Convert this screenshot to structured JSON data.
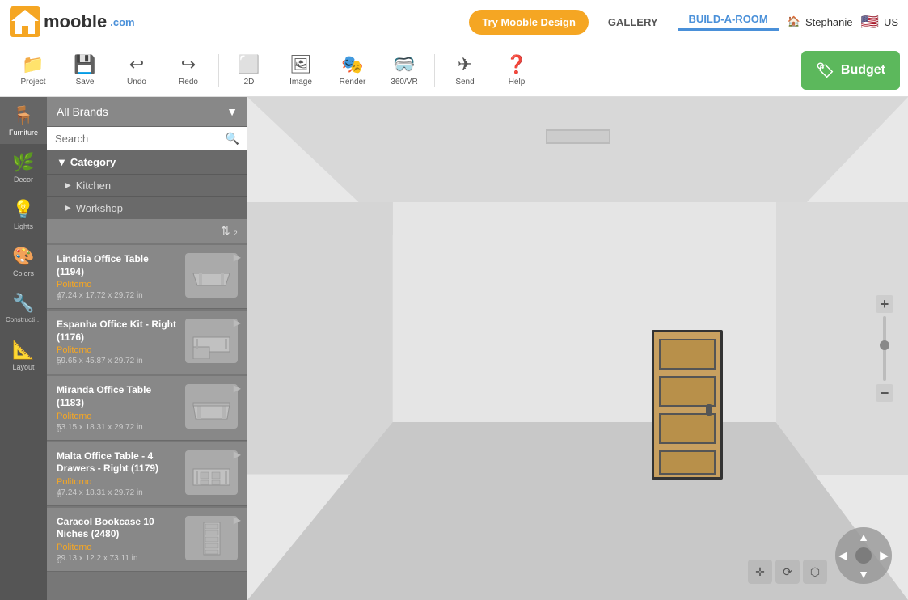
{
  "app": {
    "name": "mooble",
    "domain": ".com"
  },
  "topnav": {
    "try_btn": "Try Mooble Design",
    "gallery": "GALLERY",
    "build_a_room": "BUILD-A-ROOM",
    "user": "Stephanie",
    "region": "US"
  },
  "toolbar": {
    "project": "Project",
    "save": "Save",
    "undo": "Undo",
    "redo": "Redo",
    "twod": "2D",
    "image": "Image",
    "render": "Render",
    "vr": "360/VR",
    "send": "Send",
    "help": "Help",
    "budget": "Budget"
  },
  "sidebar": {
    "items": [
      {
        "label": "Furniture",
        "icon": "🪑"
      },
      {
        "label": "Decor",
        "icon": "🌿"
      },
      {
        "label": "Lights",
        "icon": "💡"
      },
      {
        "label": "Colors",
        "icon": "🎨"
      },
      {
        "label": "Construction",
        "icon": "🔧"
      },
      {
        "label": "Layout",
        "icon": "📐"
      }
    ]
  },
  "panel": {
    "brand_label": "All Brands",
    "search_placeholder": "Search",
    "category_header": "Category",
    "categories": [
      {
        "label": "Kitchen"
      },
      {
        "label": "Workshop"
      }
    ],
    "products": [
      {
        "name": "Lindóia Office Table (1194)",
        "brand": "Politorno",
        "dims": "47.24 x 17.72 x 29.72 in"
      },
      {
        "name": "Espanha Office Kit - Right (1176)",
        "brand": "Politorno",
        "dims": "59.65 x 45.87 x 29.72 in"
      },
      {
        "name": "Miranda Office Table (1183)",
        "brand": "Politorno",
        "dims": "53.15 x 18.31 x 29.72 in"
      },
      {
        "name": "Malta Office Table - 4 Drawers - Right (1179)",
        "brand": "Politorno",
        "dims": "47.24 x 18.31 x 29.72 in"
      },
      {
        "name": "Caracol Bookcase 10 Niches (2480)",
        "brand": "Politorno",
        "dims": "29.13 x 12.2 x 73.11 in"
      }
    ]
  }
}
